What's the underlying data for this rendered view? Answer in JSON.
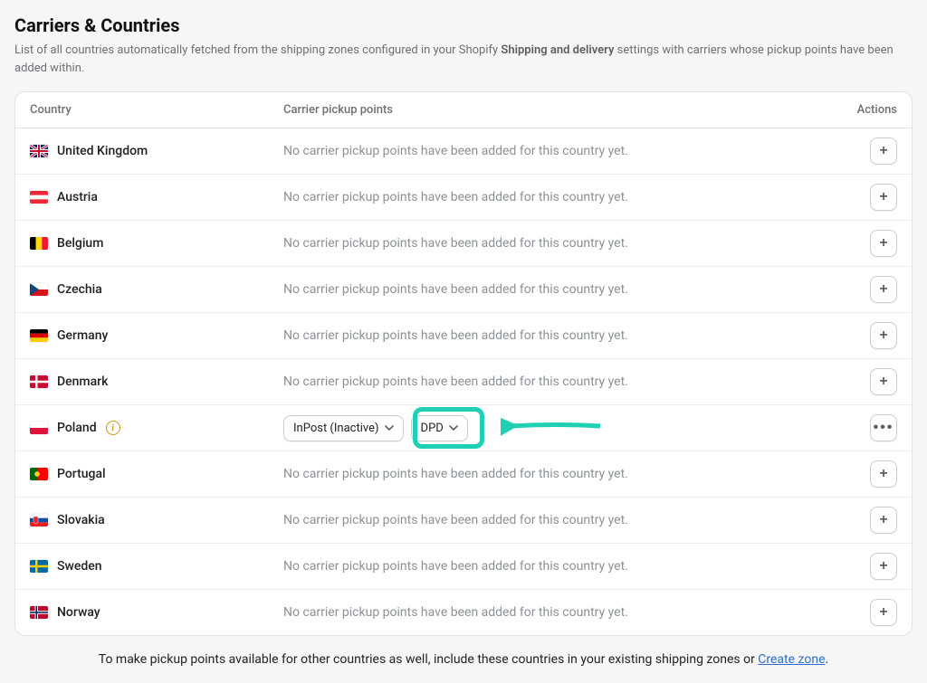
{
  "header": {
    "title": "Carriers & Countries",
    "description_pre": "List of all countries automatically fetched from the shipping zones configured in your Shopify ",
    "description_bold": "Shipping and delivery",
    "description_post": " settings with carriers whose pickup points have been added within."
  },
  "columns": {
    "country": "Country",
    "carrier": "Carrier pickup points",
    "actions": "Actions"
  },
  "empty_text": "No carrier pickup points have been added for this country yet.",
  "add_icon": "+",
  "more_icon": "•••",
  "info_icon": "i",
  "footer": {
    "text": "To make pickup points available for other countries as well, include these countries in your existing shipping zones or ",
    "link": "Create zone",
    "suffix": "."
  },
  "poland_carriers": {
    "inpost": "InPost (Inactive)",
    "dpd": "DPD"
  },
  "countries": [
    {
      "name": "United Kingdom",
      "code": "gb"
    },
    {
      "name": "Austria",
      "code": "at"
    },
    {
      "name": "Belgium",
      "code": "be"
    },
    {
      "name": "Czechia",
      "code": "cz"
    },
    {
      "name": "Germany",
      "code": "de"
    },
    {
      "name": "Denmark",
      "code": "dk"
    },
    {
      "name": "Poland",
      "code": "pl"
    },
    {
      "name": "Portugal",
      "code": "pt"
    },
    {
      "name": "Slovakia",
      "code": "sk"
    },
    {
      "name": "Sweden",
      "code": "se"
    },
    {
      "name": "Norway",
      "code": "no"
    }
  ]
}
